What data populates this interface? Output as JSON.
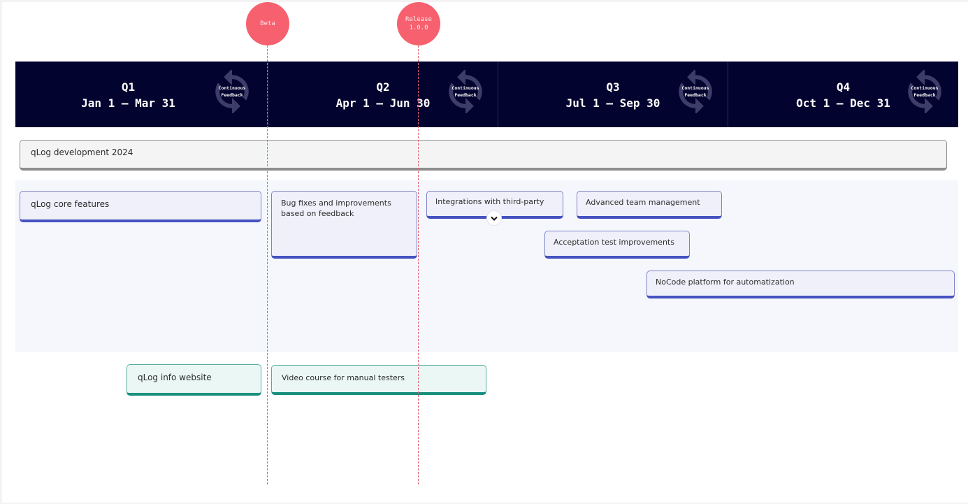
{
  "milestones": [
    {
      "label": "Beta",
      "color": "#f7616f"
    },
    {
      "label": "Release\n1.0.0",
      "color": "#f7616f"
    }
  ],
  "quarters": [
    {
      "name": "Q1",
      "range": "Jan 1 – Mar 31",
      "badge": "Continuous\nFeedback"
    },
    {
      "name": "Q2",
      "range": "Apr 1 – Jun 30",
      "badge": "Continuous\nFeedback"
    },
    {
      "name": "Q3",
      "range": "Jul 1 – Sep 30",
      "badge": "Continuous\nFeedback"
    },
    {
      "name": "Q4",
      "range": "Oct 1 – Dec 31",
      "badge": "Continuous\nFeedback"
    }
  ],
  "header_color": "#03032f",
  "epic": {
    "label": "qLog development 2024"
  },
  "development_lane": {
    "items": [
      {
        "label": "qLog core features"
      },
      {
        "label": "Bug fixes and improvements based on feedback"
      },
      {
        "label": "Integrations with third-party"
      },
      {
        "label": "Advanced team management"
      },
      {
        "label": "Acceptation test improvements"
      },
      {
        "label": "NoCode platform for automatization"
      }
    ],
    "accent": "#4552c0"
  },
  "marketing_lane": {
    "items": [
      {
        "label": "qLog info website"
      },
      {
        "label": "Video course for manual testers"
      }
    ],
    "accent": "#198f7e"
  },
  "icons": {
    "expand": "chevron-down-icon",
    "cycle": "refresh-cycle-icon"
  }
}
